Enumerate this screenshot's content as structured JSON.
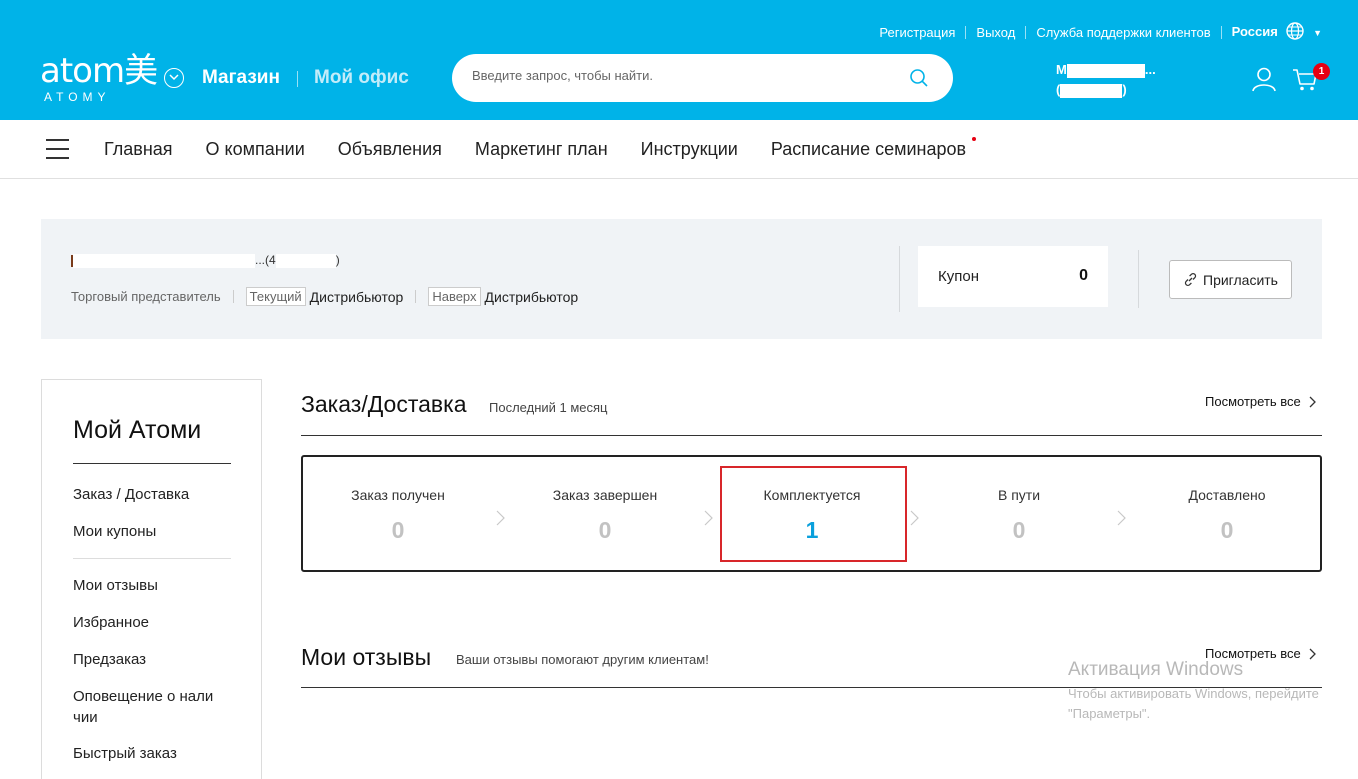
{
  "header": {
    "top_links": [
      "Регистрация",
      "Выход",
      "Служба поддержки клиентов"
    ],
    "country": "Россия",
    "logo_word": "atom美",
    "logo_sub": "ATOMY",
    "nav_shop": "Магазин",
    "nav_office": "Мой офис",
    "search_placeholder": "Введите запрос, чтобы найти.",
    "user_line1_prefix": "M",
    "user_line1_suffix": "...",
    "user_line2_open": "(",
    "user_line2_close": ")",
    "cart_count": "1"
  },
  "main_nav": [
    "Главная",
    "О компании",
    "Объявления",
    "Маркетинг план",
    "Инструкции",
    "Расписание семинаров"
  ],
  "profile": {
    "name_suffix": "...",
    "id_open": "(4",
    "id_close": ")",
    "role": "Торговый представитель",
    "current_tag": "Текущий",
    "current_value": "Дистрибьютор",
    "upper_tag": "Наверх",
    "upper_value": "Дистрибьютор",
    "coupon_label": "Купон",
    "coupon_count": "0",
    "invite_label": "Пригласить"
  },
  "sidebar": {
    "title": "Мой Атоми",
    "items": [
      "Заказ / Доставка",
      "Мои купоны",
      "Мои отзывы",
      "Избранное",
      "Предзаказ",
      "Оповещение о нали чии",
      "Быстрый заказ"
    ]
  },
  "orders": {
    "title": "Заказ/Доставка",
    "subtitle": "Последний 1 месяц",
    "view_all": "Посмотреть все",
    "steps": [
      {
        "label": "Заказ получен",
        "count": "0"
      },
      {
        "label": "Заказ завершен",
        "count": "0"
      },
      {
        "label": "Комплектуется",
        "count": "1"
      },
      {
        "label": "В пути",
        "count": "0"
      },
      {
        "label": "Доставлено",
        "count": "0"
      }
    ]
  },
  "reviews": {
    "title": "Мои отзывы",
    "subtitle": "Ваши отзывы помогают другим клиентам!",
    "view_all": "Посмотреть все"
  },
  "watermark": {
    "line1": "Активация Windows",
    "line2": "Чтобы активировать Windows, перейдите",
    "line3": "\"Параметры\"."
  },
  "colors": {
    "brand": "#00b3e8",
    "active_count": "#0aa0dc",
    "highlight": "#d8262a",
    "badge": "#e60012"
  }
}
